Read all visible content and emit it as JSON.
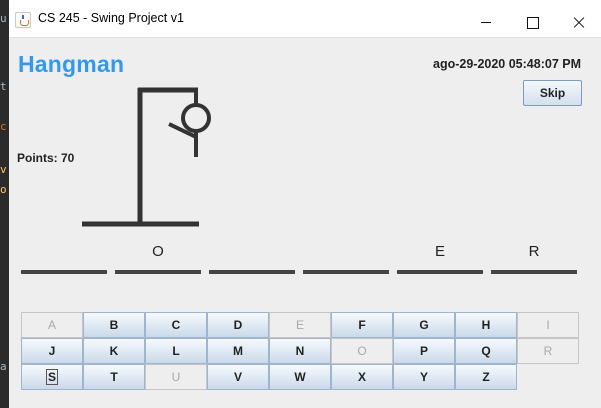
{
  "window": {
    "title": "CS 245 - Swing Project v1"
  },
  "header": {
    "game_title": "Hangman",
    "datetime": "ago-29-2020 05:48:07 PM",
    "skip_label": "Skip"
  },
  "score": {
    "points_label": "Points: 70"
  },
  "word": {
    "slots": [
      "",
      "O",
      "",
      "",
      "E",
      "R"
    ]
  },
  "keyboard": {
    "rows": [
      [
        {
          "letter": "A",
          "enabled": false
        },
        {
          "letter": "B",
          "enabled": true
        },
        {
          "letter": "C",
          "enabled": true
        },
        {
          "letter": "D",
          "enabled": true
        },
        {
          "letter": "E",
          "enabled": false
        },
        {
          "letter": "F",
          "enabled": true
        },
        {
          "letter": "G",
          "enabled": true
        },
        {
          "letter": "H",
          "enabled": true
        },
        {
          "letter": "I",
          "enabled": false
        }
      ],
      [
        {
          "letter": "J",
          "enabled": true
        },
        {
          "letter": "K",
          "enabled": true
        },
        {
          "letter": "L",
          "enabled": true
        },
        {
          "letter": "M",
          "enabled": true
        },
        {
          "letter": "N",
          "enabled": true
        },
        {
          "letter": "O",
          "enabled": false
        },
        {
          "letter": "P",
          "enabled": true
        },
        {
          "letter": "Q",
          "enabled": true
        },
        {
          "letter": "R",
          "enabled": false
        }
      ],
      [
        {
          "letter": "S",
          "enabled": true,
          "focused": true
        },
        {
          "letter": "T",
          "enabled": true
        },
        {
          "letter": "U",
          "enabled": false
        },
        {
          "letter": "V",
          "enabled": true
        },
        {
          "letter": "W",
          "enabled": true
        },
        {
          "letter": "X",
          "enabled": true
        },
        {
          "letter": "Y",
          "enabled": true
        },
        {
          "letter": "Z",
          "enabled": true
        }
      ]
    ]
  },
  "background_code": [
    {
      "text": "u",
      "color": "#a9b7c6"
    },
    {
      "text": "t",
      "color": "#a9b7c6"
    },
    {
      "text": "c",
      "color": "#cc7832"
    },
    {
      "text": "v",
      "color": "#ffc66d"
    },
    {
      "text": "o",
      "color": "#ffc66d"
    },
    {
      "text": "a",
      "color": "#a9b7c6"
    }
  ],
  "colors": {
    "title_blue": "#3399ee",
    "window_bg": "#eeeeee",
    "gallows": "#333333"
  }
}
